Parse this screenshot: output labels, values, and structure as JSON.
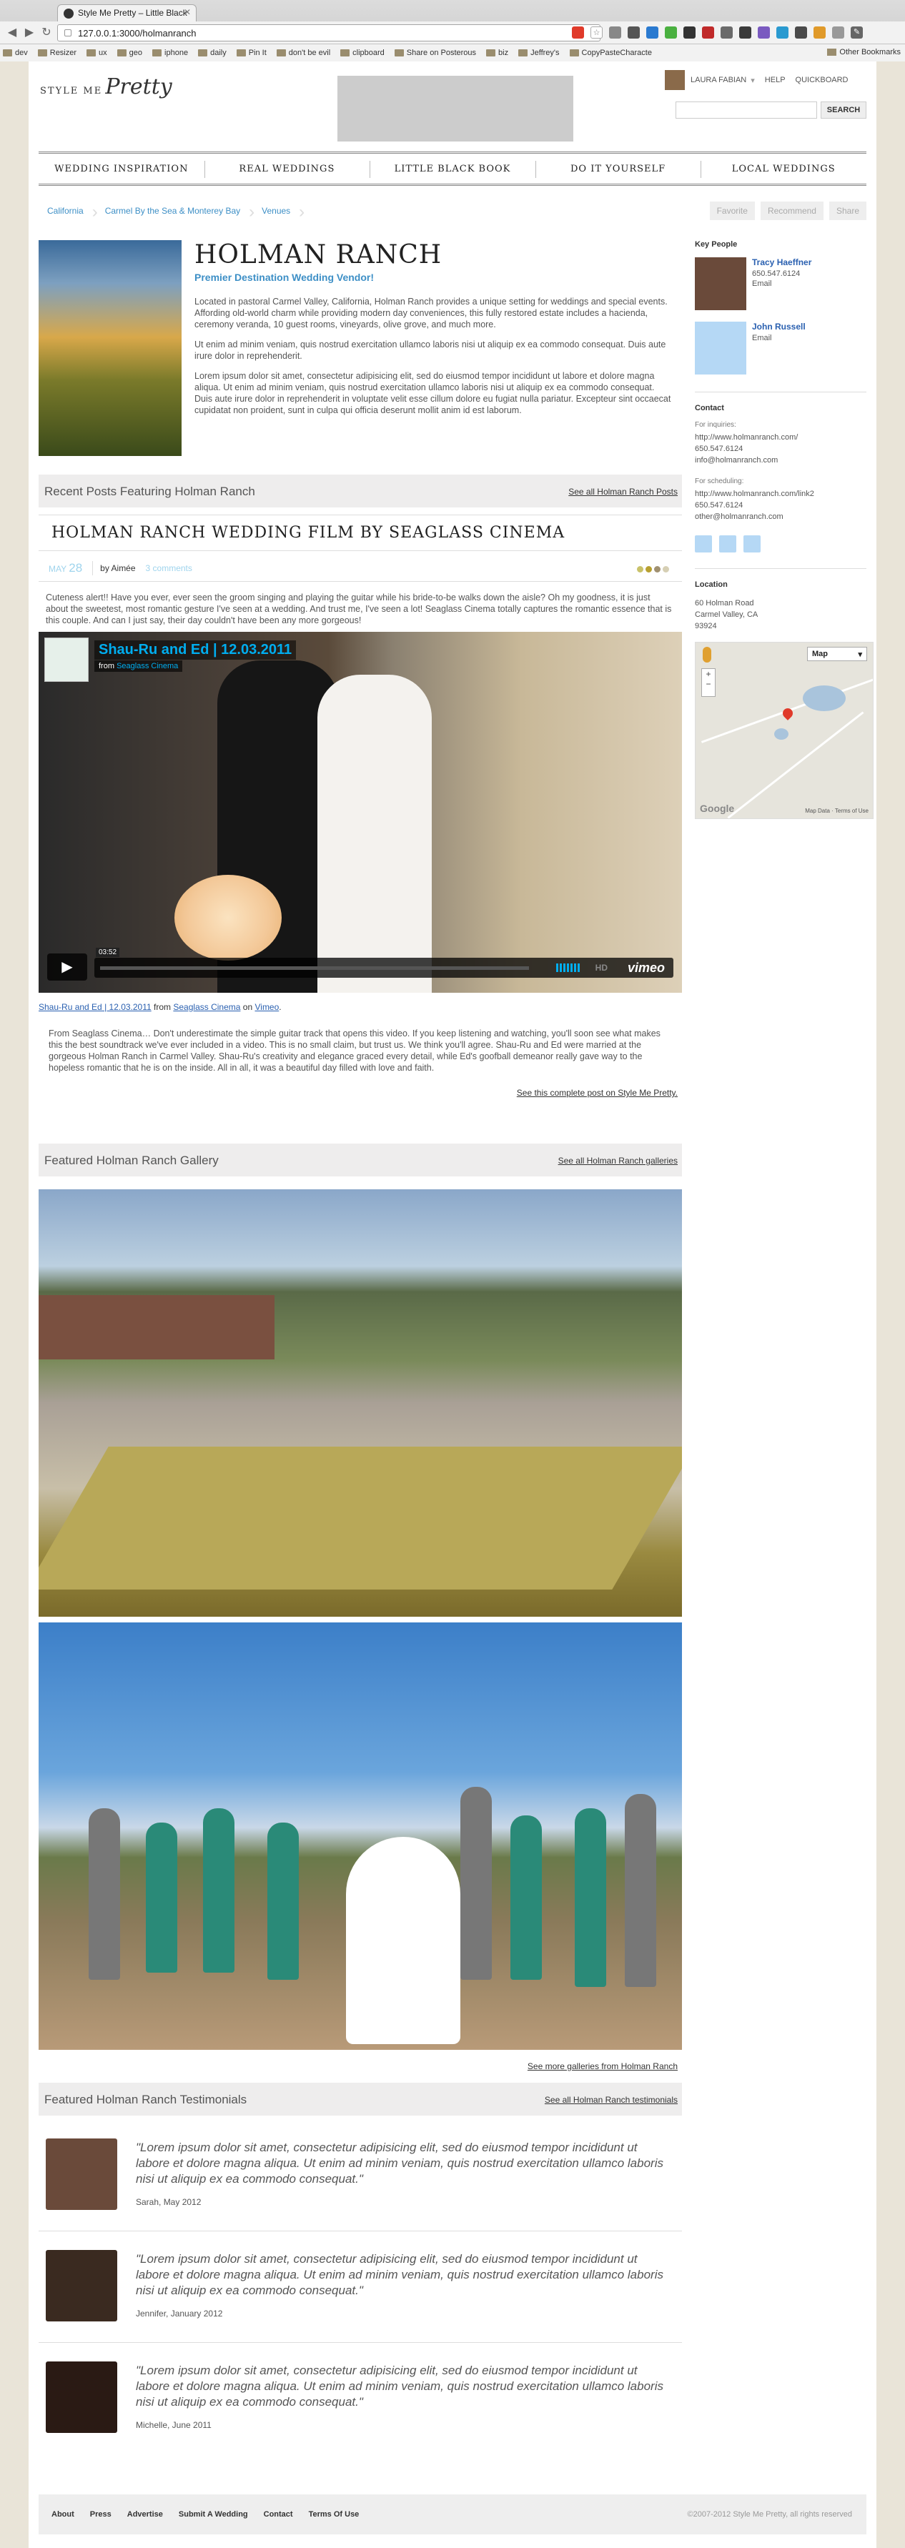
{
  "browser": {
    "tab_title": "Style Me Pretty – Little Black",
    "url": "127.0.0.1:3000/holmanranch",
    "bookmarks": [
      "dev",
      "Resizer",
      "ux",
      "geo",
      "iphone",
      "daily",
      "Pin It",
      "don't be evil",
      "clipboard",
      "Share on Posterous",
      "biz",
      "Jeffrey's",
      "CopyPasteCharacte"
    ],
    "other_bookmarks": "Other Bookmarks"
  },
  "header": {
    "logo_top": "STYLE ME",
    "logo_script": "Pretty",
    "user_name": "LAURA FABIAN",
    "help": "HELP",
    "quickboard": "QUICKBOARD",
    "search_button": "SEARCH"
  },
  "nav": [
    "WEDDING INSPIRATION",
    "REAL WEDDINGS",
    "LITTLE BLACK BOOK",
    "DO IT YOURSELF",
    "LOCAL WEDDINGS"
  ],
  "breadcrumb": [
    "California",
    "Carmel By the Sea & Monterey Bay",
    "Venues"
  ],
  "actions": [
    "Favorite",
    "Recommend",
    "Share"
  ],
  "venue": {
    "name": "HOLMAN RANCH",
    "tagline": "Premier Destination Wedding Vendor!",
    "desc": [
      "Located in pastoral Carmel Valley, California, Holman Ranch provides a unique setting for weddings and special events. Affording old-world charm while providing modern day conveniences, this fully restored estate includes a hacienda, ceremony veranda, 10 guest rooms, vineyards, olive grove, and much more.",
      "Ut enim ad minim veniam, quis nostrud exercitation ullamco laboris nisi ut aliquip ex ea commodo consequat. Duis aute irure dolor in reprehenderit.",
      "Lorem ipsum dolor sit amet, consectetur adipisicing elit, sed do eiusmod tempor incididunt ut labore et dolore magna aliqua. Ut enim ad minim veniam, quis nostrud exercitation ullamco laboris nisi ut aliquip ex ea commodo consequat. Duis aute irure dolor in reprehenderit in voluptate velit esse cillum dolore eu fugiat nulla pariatur. Excepteur sint occaecat cupidatat non proident, sunt in culpa qui officia deserunt mollit anim id est laborum."
    ]
  },
  "recent_posts": {
    "title": "Recent Posts Featuring Holman Ranch",
    "link": "See all Holman Ranch Posts",
    "post_title": "HOLMAN RANCH WEDDING FILM BY SEAGLASS CINEMA",
    "month": "MAY",
    "day": "28",
    "by": "by Aimée",
    "comments": "3 comments",
    "dot_colors": [
      "#c9c26a",
      "#b8a030",
      "#a09070",
      "#d6cfb4"
    ],
    "intro": "Cuteness alert!! Have you ever, ever seen the groom singing and playing the guitar while his bride-to-be walks down the aisle? Oh my goodness, it is just about the sweetest, most romantic gesture I've seen at a wedding. And trust me, I've seen a lot! Seaglass Cinema totally captures the romantic essence that is this couple. And can I just say, their day couldn't have been any more gorgeous!",
    "video": {
      "title": "Shau-Ru and Ed | 12.03.2011",
      "from_label": "from",
      "from_name": "Seaglass Cinema",
      "time": "03:52",
      "brand": "vimeo",
      "hd": "HD"
    },
    "caption_link1": "Shau-Ru and Ed | 12.03.2011",
    "caption_from": "from",
    "caption_link2": "Seaglass Cinema",
    "caption_on": "on",
    "caption_link3": "Vimeo",
    "caption_end": ".",
    "body": "From Seaglass Cinema… Don't underestimate the simple guitar track that opens this video. If you keep listening and watching, you'll soon see what makes this the best soundtrack we've ever included in a video. This is no small claim, but trust us. We think you'll agree. Shau-Ru and Ed were married at the gorgeous Holman Ranch in Carmel Valley. Shau-Ru's creativity and elegance graced every detail, while Ed's goofball demeanor really gave way to the hopeless romantic that he is on the inside. All in all, it was a beautiful day filled with love and faith.",
    "see_post": "See this complete post on Style Me Pretty."
  },
  "gallery": {
    "title": "Featured Holman Ranch Gallery",
    "link": "See all Holman Ranch galleries",
    "more": "See more galleries from Holman Ranch"
  },
  "testimonials": {
    "title": "Featured Holman Ranch Testimonials",
    "link": "See all Holman Ranch testimonials",
    "items": [
      {
        "quote": "\"Lorem ipsum dolor sit amet, consectetur adipisicing elit, sed do eiusmod tempor incididunt ut labore et dolore magna aliqua. Ut enim ad minim veniam, quis nostrud exercitation ullamco laboris nisi ut aliquip ex ea commodo consequat.\"",
        "by": "Sarah, May 2012"
      },
      {
        "quote": "\"Lorem ipsum dolor sit amet, consectetur adipisicing elit, sed do eiusmod tempor incididunt ut labore et dolore magna aliqua. Ut enim ad minim veniam, quis nostrud exercitation ullamco laboris nisi ut aliquip ex ea commodo consequat.\"",
        "by": "Jennifer, January 2012"
      },
      {
        "quote": "\"Lorem ipsum dolor sit amet, consectetur adipisicing elit, sed do eiusmod tempor incididunt ut labore et dolore magna aliqua. Ut enim ad minim veniam, quis nostrud exercitation ullamco laboris nisi ut aliquip ex ea commodo consequat.\"",
        "by": "Michelle, June 2011"
      }
    ]
  },
  "sidebar": {
    "key_people_title": "Key People",
    "people": [
      {
        "name": "Tracy Haeffner",
        "phone": "650.547.6124",
        "email": "Email"
      },
      {
        "name": "John Russell",
        "phone": "",
        "email": "Email"
      }
    ],
    "contact_title": "Contact",
    "inquiries_label": "For inquiries:",
    "inquiries": [
      "http://www.holmanranch.com/",
      "650.547.6124",
      "info@holmanranch.com"
    ],
    "scheduling_label": "For scheduling:",
    "scheduling": [
      "http://www.holmanranch.com/link2",
      "650.547.6124",
      "other@holmanranch.com"
    ],
    "location_title": "Location",
    "address": [
      "60 Holman Road",
      "Carmel Valley, CA",
      "93924"
    ],
    "map_type": "Map",
    "map_terms": "Map Data · Terms of Use",
    "google": "Google"
  },
  "footer": {
    "links": [
      "About",
      "Press",
      "Advertise",
      "Submit A Wedding",
      "Contact",
      "Terms Of Use"
    ],
    "copyright": "©2007-2012 Style Me Pretty, all rights reserved"
  },
  "colors": {
    "accent": "#3d8fc6",
    "soft_blue": "#9fd4ed",
    "video_accent": "#00adef"
  }
}
